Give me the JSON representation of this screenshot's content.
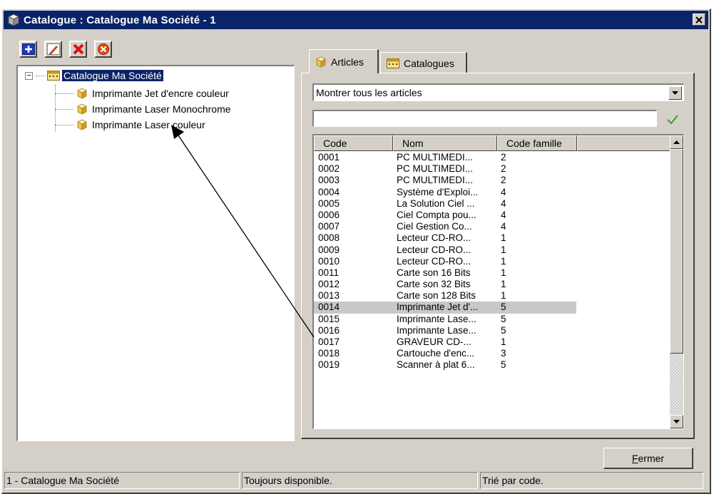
{
  "window": {
    "title": "Catalogue : Catalogue Ma Société - 1"
  },
  "toolbar": {
    "buttons": [
      {
        "name": "add",
        "icon": "plus-icon"
      },
      {
        "name": "edit",
        "icon": "pencil-icon"
      },
      {
        "name": "delete",
        "icon": "red-x-icon"
      },
      {
        "name": "cancel",
        "icon": "no-entry-icon"
      }
    ]
  },
  "tree": {
    "root_label": "Catalogue Ma Société",
    "items": [
      "Imprimante Jet d'encre couleur",
      "Imprimante Laser Monochrome",
      "Imprimante Laser couleur"
    ]
  },
  "tabs": [
    {
      "label": "Articles",
      "icon": "cube-icon",
      "active": true
    },
    {
      "label": "Catalogues",
      "icon": "catalog-icon",
      "active": false
    }
  ],
  "filter": {
    "dropdown_value": "Montrer tous les articles",
    "search_value": ""
  },
  "grid": {
    "columns": [
      "Code",
      "Nom",
      "Code famille",
      ""
    ],
    "selected_code": "0014",
    "rows": [
      {
        "code": "0001",
        "nom": "PC MULTIMEDI...",
        "fam": "2"
      },
      {
        "code": "0002",
        "nom": "PC MULTIMEDI...",
        "fam": "2"
      },
      {
        "code": "0003",
        "nom": "PC MULTIMEDI...",
        "fam": "2"
      },
      {
        "code": "0004",
        "nom": "Système d'Exploi...",
        "fam": "4"
      },
      {
        "code": "0005",
        "nom": "La Solution Ciel ...",
        "fam": "4"
      },
      {
        "code": "0006",
        "nom": "Ciel Compta pou...",
        "fam": "4"
      },
      {
        "code": "0007",
        "nom": "Ciel Gestion Co...",
        "fam": "4"
      },
      {
        "code": "0008",
        "nom": "Lecteur CD-RO...",
        "fam": "1"
      },
      {
        "code": "0009",
        "nom": "Lecteur CD-RO...",
        "fam": "1"
      },
      {
        "code": "0010",
        "nom": "Lecteur CD-RO...",
        "fam": "1"
      },
      {
        "code": "0011",
        "nom": "Carte son 16 Bits",
        "fam": "1"
      },
      {
        "code": "0012",
        "nom": "Carte son 32 Bits",
        "fam": "1"
      },
      {
        "code": "0013",
        "nom": "Carte son 128 Bits",
        "fam": "1"
      },
      {
        "code": "0014",
        "nom": "Imprimante Jet d'...",
        "fam": "5"
      },
      {
        "code": "0015",
        "nom": "Imprimante Lase...",
        "fam": "5"
      },
      {
        "code": "0016",
        "nom": "Imprimante Lase...",
        "fam": "5"
      },
      {
        "code": "0017",
        "nom": "GRAVEUR CD-...",
        "fam": "1"
      },
      {
        "code": "0018",
        "nom": "Cartouche d'enc...",
        "fam": "3"
      },
      {
        "code": "0019",
        "nom": "Scanner à plat 6...",
        "fam": "5"
      }
    ]
  },
  "buttons": {
    "close_label": "Fermer"
  },
  "status": {
    "pane1": "1 - Catalogue Ma Société",
    "pane2": "Toujours disponible.",
    "pane3": "Trié par code."
  },
  "colors": {
    "titlebar": "#0a246a",
    "face": "#d4d0c8",
    "selection_row": "#c8c8c8"
  }
}
